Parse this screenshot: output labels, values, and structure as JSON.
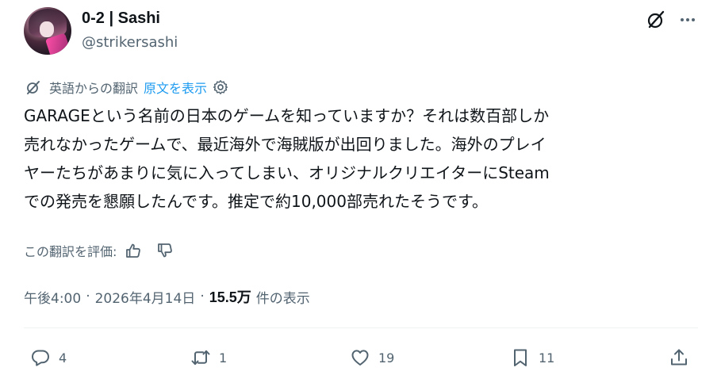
{
  "author": {
    "display_name": "0-2 | Sashi",
    "handle": "@strikersashi"
  },
  "translation": {
    "label": "英語からの翻訳",
    "show_original": "原文を表示"
  },
  "tweet": {
    "lines": [
      "GARAGEという名前の日本のゲームを知っていますか？それは数百部しか",
      "売れなかったゲームで、最近海外で海賊版が出回りました。海外のプレイ",
      "ヤーたちがあまりに気に入ってしまい、オリジナルクリエイターにSteam",
      "での発売を懇願したんです。推定で約10,000部売れたそうです。"
    ]
  },
  "rating": {
    "label": "この翻訳を評価:"
  },
  "meta": {
    "time": "午後4:00",
    "date": "2026年4月14日",
    "separator": "·",
    "views_count": "15.5万",
    "views_label": "件の表示"
  },
  "actions": {
    "replies": "4",
    "reposts": "1",
    "likes": "19",
    "bookmarks": "11"
  },
  "icons": {
    "grok": "grok-icon",
    "more": "more-icon",
    "translate": "translate-icon",
    "settings": "gear-icon",
    "thumbs_up": "thumbs-up-icon",
    "thumbs_down": "thumbs-down-icon",
    "reply": "reply-icon",
    "repost": "repost-icon",
    "like": "heart-icon",
    "bookmark": "bookmark-icon",
    "share": "share-icon"
  },
  "colors": {
    "text": "#0f1419",
    "secondary": "#536471",
    "link": "#1d9bf0",
    "divider": "#eff3f4"
  }
}
